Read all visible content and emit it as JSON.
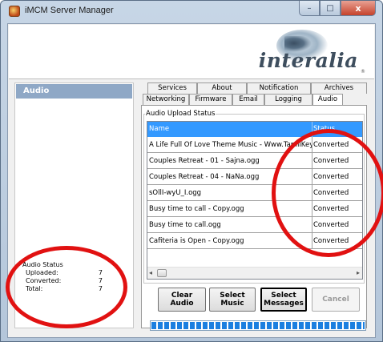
{
  "window": {
    "title": "iMCM Server Manager",
    "controls": {
      "minimize": "–",
      "maximize": "□",
      "close": "x"
    }
  },
  "banner": {
    "logo_text": "interalia",
    "logo_mark": "®"
  },
  "left_panel": {
    "header": "Audio",
    "status": {
      "title": "Audio Status",
      "rows": [
        {
          "label": "Uploaded:",
          "value": "7"
        },
        {
          "label": "Converted:",
          "value": "7"
        },
        {
          "label": "Total:",
          "value": "7"
        }
      ]
    }
  },
  "tabs": {
    "row1": [
      "Services",
      "About",
      "Notification",
      "Archives"
    ],
    "row2": [
      "Networking",
      "Firmware",
      "Email",
      "Logging",
      "Audio"
    ],
    "active": "Audio"
  },
  "upload_group": {
    "legend": "Audio Upload Status",
    "columns": {
      "name": "Name",
      "status": "Status"
    },
    "rows": [
      {
        "name": "A Life Full Of Love Theme Music - Www.TamilKey.Com",
        "status": "Converted"
      },
      {
        "name": "Couples Retreat - 01 - Sajna.ogg",
        "status": "Converted"
      },
      {
        "name": "Couples Retreat - 04 - NaNa.ogg",
        "status": "Converted"
      },
      {
        "name": "sOllI-wyU_I.ogg",
        "status": "Converted"
      },
      {
        "name": "Busy time to call - Copy.ogg",
        "status": "Converted"
      },
      {
        "name": "Busy time to call.ogg",
        "status": "Converted"
      },
      {
        "name": "Cafiteria is Open - Copy.ogg",
        "status": "Converted"
      }
    ],
    "scroll_left": "◂",
    "scroll_right": "▸"
  },
  "buttons": {
    "clear_audio": "Clear Audio",
    "select_music_1": "Select",
    "select_music_2": "Music",
    "select_messages_1": "Select",
    "select_messages_2": "Messages",
    "cancel": "Cancel"
  },
  "progress": {
    "fraction": 1.0
  },
  "colors": {
    "annotation_ring": "#e11111",
    "list_header": "#3399ff",
    "panel_header": "#8fa8c6"
  }
}
